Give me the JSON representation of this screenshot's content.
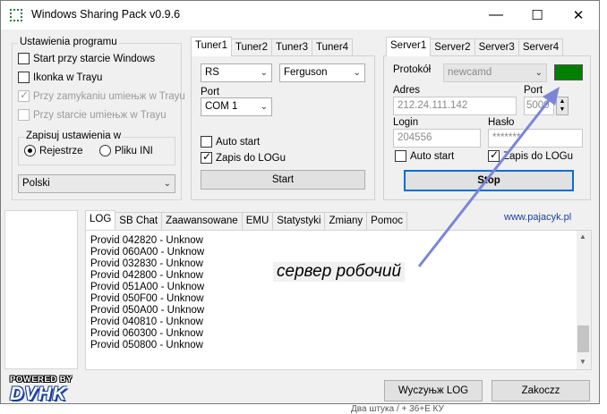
{
  "window": {
    "title": "Windows Sharing Pack v0.9.6"
  },
  "title_buttons": {
    "minimize": "—",
    "maximize": "☐",
    "close": "✕"
  },
  "settings": {
    "title": "Ustawienia programu",
    "options": [
      {
        "label": "Start przy starcie Windows",
        "checked": false,
        "disabled": false
      },
      {
        "label": "Ikonka w Trayu",
        "checked": false,
        "disabled": false
      },
      {
        "label": "Przy zamykaniu umieњж w Trayu",
        "checked": true,
        "disabled": true
      },
      {
        "label": "Przy starcie umieњж w Trayu",
        "checked": false,
        "disabled": true
      }
    ],
    "save_group": {
      "title": "Zapisuj ustawienia w",
      "options": [
        {
          "label": "Rejestrze",
          "selected": true
        },
        {
          "label": "Pliku INI",
          "selected": false
        }
      ]
    },
    "language": "Polski"
  },
  "tuners": {
    "tabs": [
      "Tuner1",
      "Tuner2",
      "Tuner3",
      "Tuner4"
    ],
    "active_tab": 0,
    "combo_a": "RS",
    "combo_b": "Ferguson",
    "port_label": "Port",
    "port_value": "COM 1",
    "autostart": "Auto start",
    "autostart_checked": false,
    "log": "Zapis do LOGu",
    "log_checked": true,
    "start_button": "Start"
  },
  "servers": {
    "tabs": [
      "Server1",
      "Server2",
      "Server3",
      "Server4"
    ],
    "active_tab": 0,
    "protocol_label": "Protokół",
    "protocol_value": "newcamd",
    "status_color": "#008000",
    "address_label": "Adres",
    "address_value": "212.24.111.142",
    "port_label": "Port",
    "port_value": "5000",
    "login_label": "Login",
    "login_value": "204556",
    "password_label": "Hasło",
    "password_value": "*******",
    "autostart": "Auto start",
    "autostart_checked": false,
    "log": "Zapis do LOGu",
    "log_checked": true,
    "stop_button": "Stop"
  },
  "bottom_tabs": [
    "LOG",
    "SB Chat",
    "Zaawansowane",
    "EMU",
    "Statystyki",
    "Zmiany",
    "Pomoc"
  ],
  "website": "www.pajacyk.pl",
  "log_lines": [
    "Provid 042820 - Unknow",
    "Provid 060A00 - Unknow",
    "Provid 032830 - Unknow",
    "Provid 042800 - Unknow",
    "Provid 051A00 - Unknow",
    "Provid 050F00 - Unknow",
    "Provid 050A00 - Unknow",
    "Provid 040810 - Unknow",
    "Provid 060300 - Unknow",
    "Provid 050800 - Unknow"
  ],
  "annotation": "сервер робочий",
  "logo": {
    "line1": "POWERED BY",
    "line2": "DVHK"
  },
  "buttons": {
    "clear_log": "Wyczyњж LOG",
    "close": "Zakoczz"
  },
  "background_snippet": "Два штука / + 36+Е КУ"
}
